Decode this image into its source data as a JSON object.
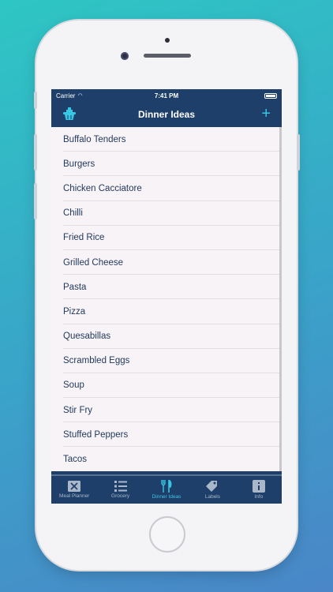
{
  "status": {
    "carrier": "Carrier",
    "time": "7:41 PM"
  },
  "navbar": {
    "title": "Dinner Ideas",
    "add_symbol": "+"
  },
  "dinner_ideas": [
    "Buffalo Tenders",
    "Burgers",
    "Chicken Cacciatore",
    "Chilli",
    "Fried Rice",
    "Grilled Cheese",
    "Pasta",
    "Pizza",
    "Quesabillas",
    "Scrambled Eggs",
    "Soup",
    "Stir Fry",
    "Stuffed Peppers",
    "Tacos"
  ],
  "tabs": [
    {
      "label": "Meal Planner",
      "icon": "meal-planner-icon",
      "active": false
    },
    {
      "label": "Grocery",
      "icon": "list-icon",
      "active": false
    },
    {
      "label": "Dinner Ideas",
      "icon": "fork-knife-icon",
      "active": true
    },
    {
      "label": "Labels",
      "icon": "tags-icon",
      "active": false
    },
    {
      "label": "Info",
      "icon": "info-icon",
      "active": false
    }
  ],
  "colors": {
    "navbar_bg": "#1e3f6a",
    "accent": "#39c6e3",
    "list_bg": "#f7f3f7",
    "item_text": "#233a5c"
  }
}
